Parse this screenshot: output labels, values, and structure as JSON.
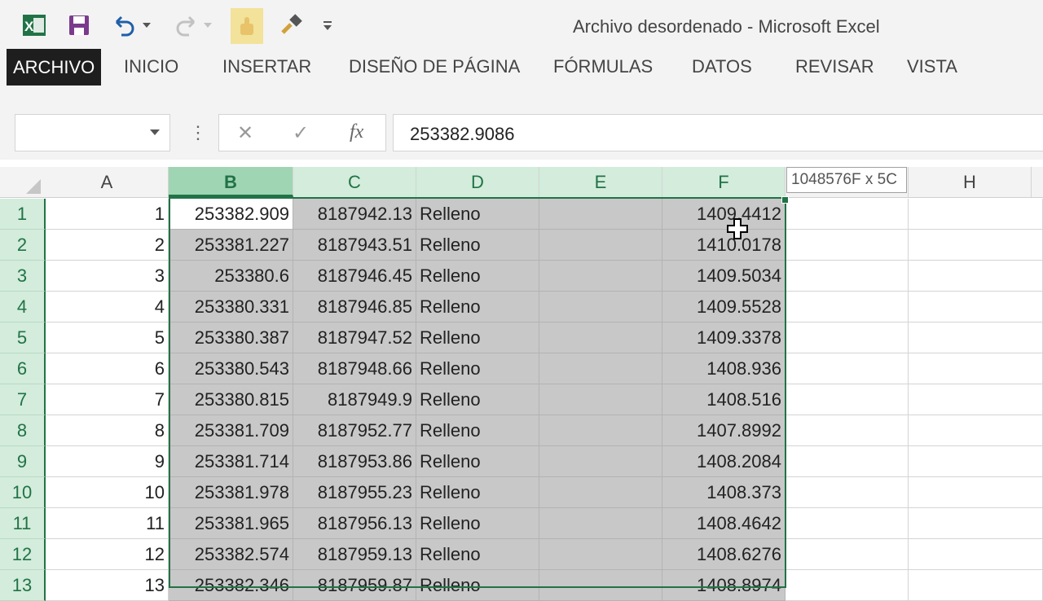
{
  "window": {
    "title": "Archivo desordenado - Microsoft Excel"
  },
  "qat": {
    "icons": [
      "excel-logo-icon",
      "save-icon",
      "undo-icon",
      "redo-icon",
      "touch-mode-icon",
      "format-painter-icon",
      "customize-qat-icon"
    ]
  },
  "ribbon": {
    "tabs": [
      {
        "label": "ARCHIVO",
        "active": true
      },
      {
        "label": "INICIO"
      },
      {
        "label": "INSERTAR"
      },
      {
        "label": "DISEÑO DE PÁGINA"
      },
      {
        "label": "FÓRMULAS"
      },
      {
        "label": "DATOS"
      },
      {
        "label": "REVISAR"
      },
      {
        "label": "VISTA"
      }
    ]
  },
  "formula_bar": {
    "name_box": "",
    "fx_label": "fx",
    "value": "253382.9086"
  },
  "selection_tooltip": "1048576F x 5C",
  "columns": [
    "A",
    "B",
    "C",
    "D",
    "E",
    "F",
    "",
    "H"
  ],
  "rows": [
    {
      "n": "1",
      "A": "1",
      "B": "253382.909",
      "C": "8187942.13",
      "D": "Relleno",
      "E": "",
      "F": "1409.4412"
    },
    {
      "n": "2",
      "A": "2",
      "B": "253381.227",
      "C": "8187943.51",
      "D": "Relleno",
      "E": "",
      "F": "1410.0178"
    },
    {
      "n": "3",
      "A": "3",
      "B": "253380.6",
      "C": "8187946.45",
      "D": "Relleno",
      "E": "",
      "F": "1409.5034"
    },
    {
      "n": "4",
      "A": "4",
      "B": "253380.331",
      "C": "8187946.85",
      "D": "Relleno",
      "E": "",
      "F": "1409.5528"
    },
    {
      "n": "5",
      "A": "5",
      "B": "253380.387",
      "C": "8187947.52",
      "D": "Relleno",
      "E": "",
      "F": "1409.3378"
    },
    {
      "n": "6",
      "A": "6",
      "B": "253380.543",
      "C": "8187948.66",
      "D": "Relleno",
      "E": "",
      "F": "1408.936"
    },
    {
      "n": "7",
      "A": "7",
      "B": "253380.815",
      "C": "8187949.9",
      "D": "Relleno",
      "E": "",
      "F": "1408.516"
    },
    {
      "n": "8",
      "A": "8",
      "B": "253381.709",
      "C": "8187952.77",
      "D": "Relleno",
      "E": "",
      "F": "1407.8992"
    },
    {
      "n": "9",
      "A": "9",
      "B": "253381.714",
      "C": "8187953.86",
      "D": "Relleno",
      "E": "",
      "F": "1408.2084"
    },
    {
      "n": "10",
      "A": "10",
      "B": "253381.978",
      "C": "8187955.23",
      "D": "Relleno",
      "E": "",
      "F": "1408.373"
    },
    {
      "n": "11",
      "A": "11",
      "B": "253381.965",
      "C": "8187956.13",
      "D": "Relleno",
      "E": "",
      "F": "1408.4642"
    },
    {
      "n": "12",
      "A": "12",
      "B": "253382.574",
      "C": "8187959.13",
      "D": "Relleno",
      "E": "",
      "F": "1408.6276"
    },
    {
      "n": "13",
      "A": "13",
      "B": "253382.346",
      "C": "8187959.87",
      "D": "Relleno",
      "E": "",
      "F": "1408.8974"
    }
  ],
  "colors": {
    "accent": "#217346",
    "header_selected": "#d3ecdc",
    "cell_selected": "#c8c8c8"
  }
}
